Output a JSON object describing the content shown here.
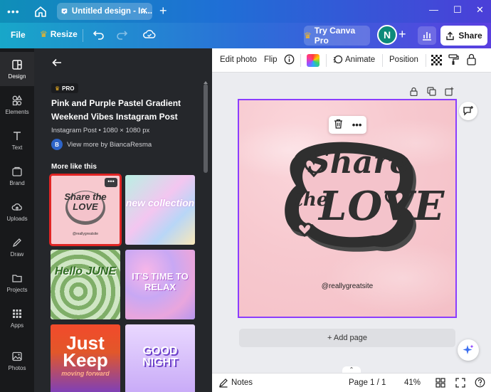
{
  "titlebar": {
    "menu_icon": "ellipsis-icon",
    "home_icon": "home-icon",
    "tab_title": "Untitled design - In...",
    "tab_close": "✕",
    "new_tab": "+",
    "minimize": "—",
    "maximize": "☐",
    "close": "✕"
  },
  "header": {
    "file": "File",
    "resize": "Resize",
    "try_canva_pro": "Try Canva Pro",
    "avatar_initial": "N",
    "share": "Share"
  },
  "rail": {
    "items": [
      {
        "label": "Design",
        "icon": "design-icon"
      },
      {
        "label": "Elements",
        "icon": "elements-icon"
      },
      {
        "label": "Text",
        "icon": "text-icon"
      },
      {
        "label": "Brand",
        "icon": "brand-icon"
      },
      {
        "label": "Uploads",
        "icon": "uploads-icon"
      },
      {
        "label": "Draw",
        "icon": "draw-icon"
      },
      {
        "label": "Projects",
        "icon": "projects-icon"
      },
      {
        "label": "Apps",
        "icon": "apps-icon"
      },
      {
        "label": "Photos",
        "icon": "photos-icon"
      }
    ]
  },
  "panel": {
    "pro_badge": "PRO",
    "template_title": "Pink and Purple Pastel Gradient Weekend Vibes Instagram Post",
    "meta": "Instagram Post • 1080 × 1080 px",
    "author_initial": "B",
    "author_text": "View more by BiancaResma",
    "more_heading": "More like this",
    "thumbs": [
      {
        "label": "Share the LOVE",
        "sub": "@reallygreatsite"
      },
      {
        "label": "new collection",
        "sub": ""
      },
      {
        "label": "Hello JUNE",
        "sub": ""
      },
      {
        "label": "IT'S TIME TO RELAX",
        "sub": ""
      },
      {
        "label": "Just Keep",
        "sub": "moving forward"
      },
      {
        "label": "GOOD NIGHT",
        "sub": ""
      }
    ]
  },
  "toolbar": {
    "edit_photo": "Edit photo",
    "flip": "Flip",
    "animate": "Animate",
    "position": "Position"
  },
  "design": {
    "headline_top": "Share",
    "headline_mid": "the",
    "headline_bottom": "LOVE",
    "site": "@reallygreatsite"
  },
  "canvas": {
    "add_page": "+ Add page"
  },
  "footer": {
    "notes": "Notes",
    "page": "Page 1 / 1",
    "zoom": "41%"
  }
}
